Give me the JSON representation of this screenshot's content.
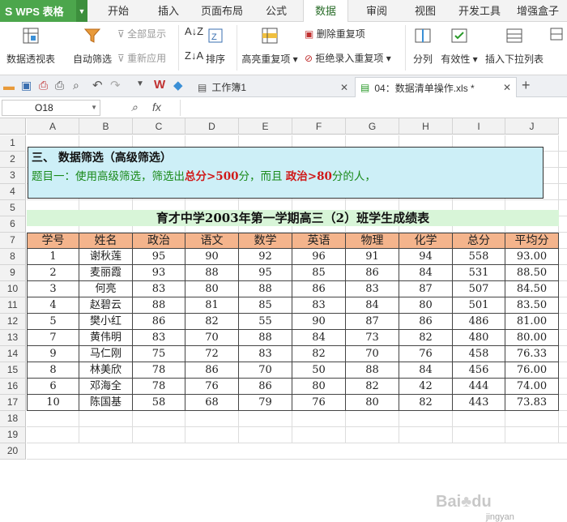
{
  "app": {
    "name": "WPS 表格"
  },
  "menu": [
    "开始",
    "插入",
    "页面布局",
    "公式",
    "数据",
    "审阅",
    "视图",
    "开发工具",
    "增强盒子"
  ],
  "menu_active": "数据",
  "ribbon": {
    "pivot": "数据透视表",
    "autofilter": "自动筛选",
    "show_all": "全部显示",
    "reapply": "重新应用",
    "sort": "排序",
    "highlight_dup": "高亮重复项",
    "remove_dup": "删除重复项",
    "reject_dup": "拒绝录入重复项",
    "split": "分列",
    "validity": "有效性",
    "dropdown": "插入下拉列表"
  },
  "docs": {
    "doc1": "工作簿1",
    "doc2": "04：数据清单操作.xls *"
  },
  "namebox": "O18",
  "fx": "fx",
  "columns": [
    "A",
    "B",
    "C",
    "D",
    "E",
    "F",
    "G",
    "H",
    "I",
    "J"
  ],
  "rows": [
    "1",
    "2",
    "3",
    "4",
    "5",
    "6",
    "7",
    "8",
    "9",
    "10",
    "11",
    "12",
    "13",
    "14",
    "15",
    "16",
    "17",
    "18",
    "19",
    "20"
  ],
  "note": {
    "line1": "三、 数据筛选（高级筛选）",
    "line2_a": "题目一：使用高级筛选，筛选出",
    "line2_b": "总分>500",
    "line2_c": "分，而且 ",
    "line2_d": "政治>80",
    "line2_e": "分的人，"
  },
  "table": {
    "title": "育才中学2003年第一学期高三（2）班学生成绩表",
    "headers": [
      "学号",
      "姓名",
      "政治",
      "语文",
      "数学",
      "英语",
      "物理",
      "化学",
      "总分",
      "平均分"
    ],
    "rows": [
      [
        "1",
        "谢秋莲",
        "95",
        "90",
        "92",
        "96",
        "91",
        "94",
        "558",
        "93.00"
      ],
      [
        "2",
        "麦丽霞",
        "93",
        "88",
        "95",
        "85",
        "86",
        "84",
        "531",
        "88.50"
      ],
      [
        "3",
        "何亮",
        "83",
        "80",
        "88",
        "86",
        "83",
        "87",
        "507",
        "84.50"
      ],
      [
        "4",
        "赵碧云",
        "88",
        "81",
        "85",
        "83",
        "84",
        "80",
        "501",
        "83.50"
      ],
      [
        "5",
        "樊小红",
        "86",
        "82",
        "55",
        "90",
        "87",
        "86",
        "486",
        "81.00"
      ],
      [
        "7",
        "黄伟明",
        "83",
        "70",
        "88",
        "84",
        "73",
        "82",
        "480",
        "80.00"
      ],
      [
        "9",
        "马仁刚",
        "75",
        "72",
        "83",
        "82",
        "70",
        "76",
        "458",
        "76.33"
      ],
      [
        "8",
        "林美欣",
        "78",
        "86",
        "70",
        "50",
        "88",
        "84",
        "456",
        "76.00"
      ],
      [
        "6",
        "邓海全",
        "78",
        "76",
        "86",
        "80",
        "82",
        "42",
        "444",
        "74.00"
      ],
      [
        "10",
        "陈国基",
        "58",
        "68",
        "79",
        "76",
        "80",
        "82",
        "443",
        "73.83"
      ]
    ]
  },
  "colors": {
    "accent": "#4ca64c",
    "header_fill": "#f4b48c",
    "title_fill": "#d8f5d8",
    "note_fill": "#cdeff7",
    "highlight": "#d01818"
  }
}
